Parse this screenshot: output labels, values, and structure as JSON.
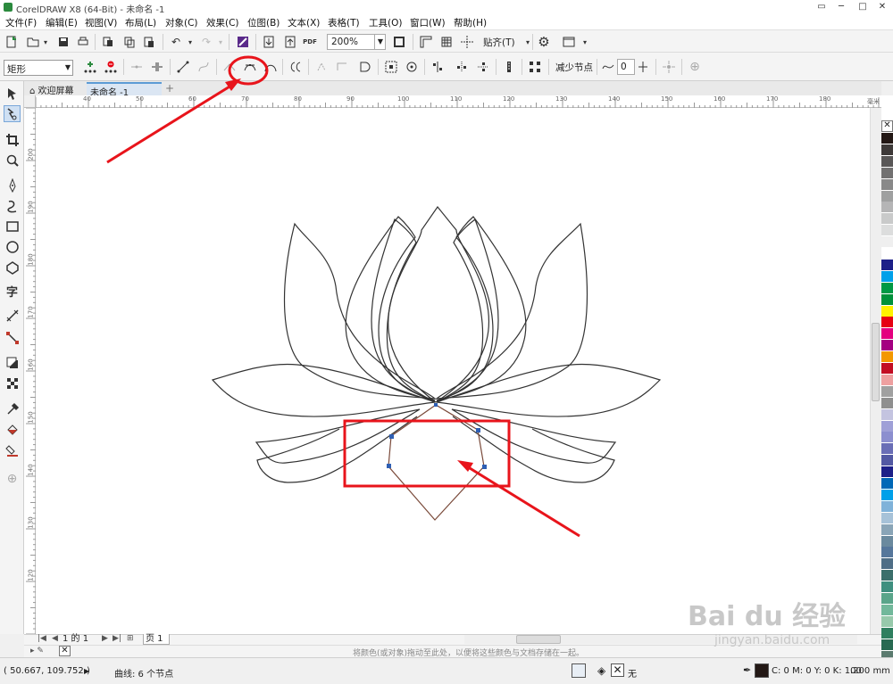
{
  "window": {
    "title": "CorelDRAW X8 (64-Bit) - 未命名 -1"
  },
  "menu": [
    "文件(F)",
    "编辑(E)",
    "视图(V)",
    "布局(L)",
    "对象(C)",
    "效果(C)",
    "位图(B)",
    "文本(X)",
    "表格(T)",
    "工具(O)",
    "窗口(W)",
    "帮助(H)"
  ],
  "toolbar": {
    "zoom": "200%",
    "snap_label": "贴齐(T)",
    "pdf_label": "PDF"
  },
  "property_bar": {
    "shape": "矩形",
    "reduce_nodes": "减少节点",
    "smoothing": "0"
  },
  "tabs": {
    "welcome": "欢迎屏幕",
    "doc": "未命名 -1",
    "add": "+"
  },
  "ruler": {
    "units": "毫米",
    "h_labels": [
      "40",
      "50",
      "60",
      "70",
      "80",
      "90",
      "100",
      "110",
      "120",
      "130",
      "140",
      "150",
      "160",
      "170",
      "180"
    ],
    "v_labels": [
      "200",
      "190",
      "180",
      "170",
      "160",
      "150",
      "140",
      "130",
      "120"
    ]
  },
  "page_nav": {
    "info": "1 的 1",
    "page_tab": "页 1"
  },
  "color_hint": "将颜色(或对象)拖动至此处，以便将这些颜色与文档存储在一起。",
  "status": {
    "coords": "( 50.667, 109.752 )",
    "object": "曲线: 6 个节点",
    "fill_none": "无",
    "cmyk": "C: 0 M: 0 Y: 0 K: 100",
    "outline_width": ".200 mm"
  },
  "watermark": {
    "brand": "Bai du 经验",
    "url": "jingyan.baidu.com"
  },
  "colors": {
    "annotation": "#e8141b",
    "node": "#2f5fb3",
    "selected_path": "#7a4a3a",
    "accent": "#5b9bd5"
  },
  "palette": [
    "#231815",
    "#3e3a39",
    "#595757",
    "#727171",
    "#898989",
    "#9fa0a0",
    "#b5b5b6",
    "#c9caca",
    "#dcdddd",
    "#efefef",
    "#ffffff",
    "#1d2088",
    "#00a0e9",
    "#009944",
    "#00913a",
    "#fff100",
    "#e60012",
    "#e4007f",
    "#a40081",
    "#f39800",
    "#c30d23",
    "#eea0a0",
    "#a0a0a0",
    "#8f8f8f",
    "#c4c4e0",
    "#9fa0d7",
    "#8c8fcf",
    "#6a6eb6",
    "#5359a3",
    "#1d2088",
    "#0068b7",
    "#00a0e9",
    "#7fb2d9",
    "#a7c2d8",
    "#8aa5b7",
    "#6b8a9e",
    "#56779b",
    "#4f6e86",
    "#3b6f6b",
    "#3f8f7f",
    "#5aa58a",
    "#72b89b",
    "#97c9ab",
    "#2f7f5f",
    "#286a52",
    "#5b7b6f",
    "#3c8e86"
  ]
}
